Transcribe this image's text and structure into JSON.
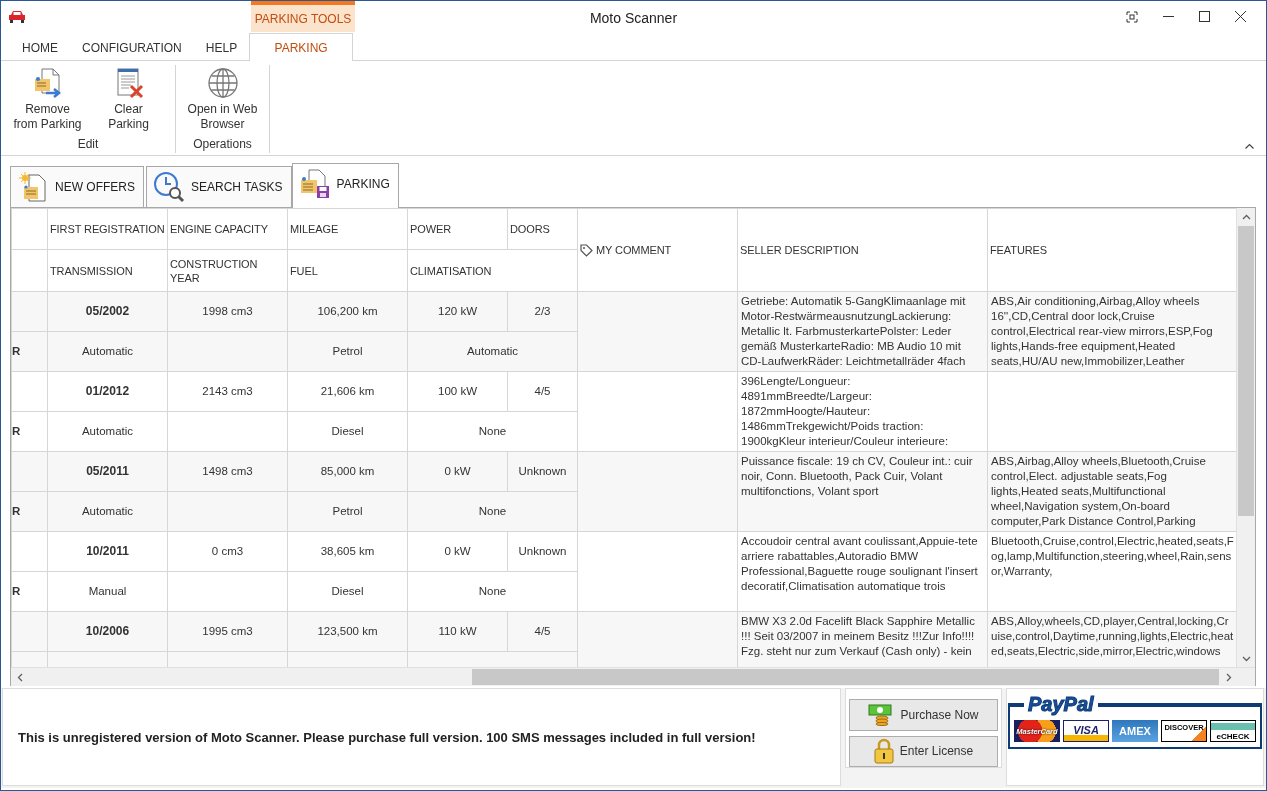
{
  "window": {
    "title": "Moto Scanner"
  },
  "ribbon": {
    "contextual_group": "PARKING TOOLS",
    "tabs": [
      {
        "label": "HOME",
        "selected": false
      },
      {
        "label": "CONFIGURATION",
        "selected": false
      },
      {
        "label": "HELP",
        "selected": false
      },
      {
        "label": "PARKING",
        "selected": true
      }
    ],
    "groups": [
      {
        "label": "Edit",
        "buttons": [
          {
            "label": "Remove from Parking",
            "kind": "remove"
          },
          {
            "label": "Clear Parking",
            "kind": "clear"
          }
        ]
      },
      {
        "label": "Operations",
        "buttons": [
          {
            "label": "Open in Web Browser",
            "kind": "browser"
          }
        ]
      }
    ]
  },
  "document_tabs": [
    {
      "label": "NEW OFFERS",
      "kind": "offers",
      "selected": false
    },
    {
      "label": "SEARCH TASKS",
      "kind": "search",
      "selected": false
    },
    {
      "label": "PARKING",
      "kind": "parking",
      "selected": true
    }
  ],
  "table": {
    "columns": {
      "line_1": [
        "FIRST REGISTRATION",
        "ENGINE CAPACITY",
        "MILEAGE",
        "POWER",
        "DOORS"
      ],
      "line_2": [
        "TRANSMISSION",
        "CONSTRUCTION YEAR",
        "FUEL",
        "CLIMATISATION"
      ],
      "spanning": [
        {
          "label": "MY COMMENT",
          "kind": "comment"
        },
        {
          "label": "SELLER DESCRIPTION",
          "kind": "text"
        },
        {
          "label": "FEATURES",
          "kind": "text"
        }
      ]
    },
    "rows": [
      {
        "first_registration": "05/2002",
        "engine_capacity": "1998 cm3",
        "mileage": "106,200 km",
        "power": "120 kW",
        "doors": "2/3",
        "column_0": "R",
        "transmission": "Automatic",
        "fuel": "Petrol",
        "climatisation": "Automatic",
        "seller_description": "Getriebe: Automatik 5-GangKlimaanlage mit Motor-RestwärmeausnutzungLackierung: Metallic lt. FarbmusterkartePolster: Leder gemäß MusterkarteRadio: MB Audio 10 mit CD-LaufwerkRäder: Leichtmetallräder 4fach",
        "features": "ABS,Air conditioning,Airbag,Alloy wheels 16'',CD,Central door lock,Cruise control,Electrical rear-view mirrors,ESP,Fog lights,Hands-free equipment,Heated seats,HU/AU new,Immobilizer,Leather"
      },
      {
        "first_registration": "01/2012",
        "engine_capacity": "2143 cm3",
        "mileage": "21,606 km",
        "power": "100 kW",
        "doors": "4/5",
        "column_0": "R",
        "transmission": "Automatic",
        "fuel": "Diesel",
        "climatisation": "None",
        "seller_description": "396Lengte/Longueur: 4891mmBreedte/Largeur: 1872mmHoogte/Hauteur: 1486mmTrekgewicht/Poids traction: 1900kgKleur interieur/Couleur interieure:"
      },
      {
        "first_registration": "05/2011",
        "engine_capacity": "1498 cm3",
        "mileage": "85,000 km",
        "power": "0 kW",
        "doors": "Unknown",
        "column_0": "R",
        "transmission": "Automatic",
        "fuel": "Petrol",
        "climatisation": "None",
        "seller_description": "Puissance fiscale: 19 ch CV, Couleur int.: cuir noir, Conn. Bluetooth, Pack Cuir, Volant multifonctions, Volant sport",
        "features": "ABS,Airbag,Alloy wheels,Bluetooth,Cruise control,Elect. adjustable seats,Fog lights,Heated seats,Multifunctional wheel,Navigation system,On-board computer,Park Distance Control,Parking"
      },
      {
        "first_registration": "10/2011",
        "engine_capacity": "0 cm3",
        "mileage": "38,605 km",
        "power": "0 kW",
        "doors": "Unknown",
        "column_0": "R",
        "transmission": "Manual",
        "fuel": "Diesel",
        "climatisation": "None",
        "seller_description": "Accoudoir central avant coulissant,Appuie-tete arriere rabattables,Autoradio BMW Professional,Baguette rouge soulignant l'insert decoratif,Climatisation automatique trois",
        "features": "Bluetooth,Cruise,control,Electric,heated,seats,Fog,lamp,Multifunction,steering,wheel,Rain,sensor,Warranty,"
      },
      {
        "first_registration": "10/2006",
        "engine_capacity": "1995 cm3",
        "mileage": "123,500 km",
        "power": "110 kW",
        "doors": "4/5",
        "seller_description": "BMW X3 2.0d Facelift Black Sapphire Metallic !!! Seit 03/2007 in meinem Besitz !!!Zur Info!!!! Fzg. steht nur zum Verkauf (Cash only) - kein",
        "features": "ABS,Alloy,wheels,CD,player,Central,locking,Cruise,control,Daytime,running,lights,Electric,heated,seats,Electric,side,mirror,Electric,windows"
      }
    ]
  },
  "notice": {
    "message": "This is unregistered version of Moto Scanner. Please purchase full version. 100 SMS messages included in full version!",
    "buttons": [
      {
        "label": "Purchase Now",
        "kind": "purchase"
      },
      {
        "label": "Enter License",
        "kind": "license"
      }
    ],
    "paypal": {
      "brand": "PayPal",
      "cards": [
        {
          "label": "MasterCard",
          "kind": "mastercard"
        },
        {
          "label": "VISA",
          "kind": "visa"
        },
        {
          "label": "AMEX",
          "kind": "amex"
        },
        {
          "label": "DISCOVER",
          "kind": "discover"
        },
        {
          "label": "eCHECK",
          "kind": "echeck"
        }
      ]
    }
  }
}
